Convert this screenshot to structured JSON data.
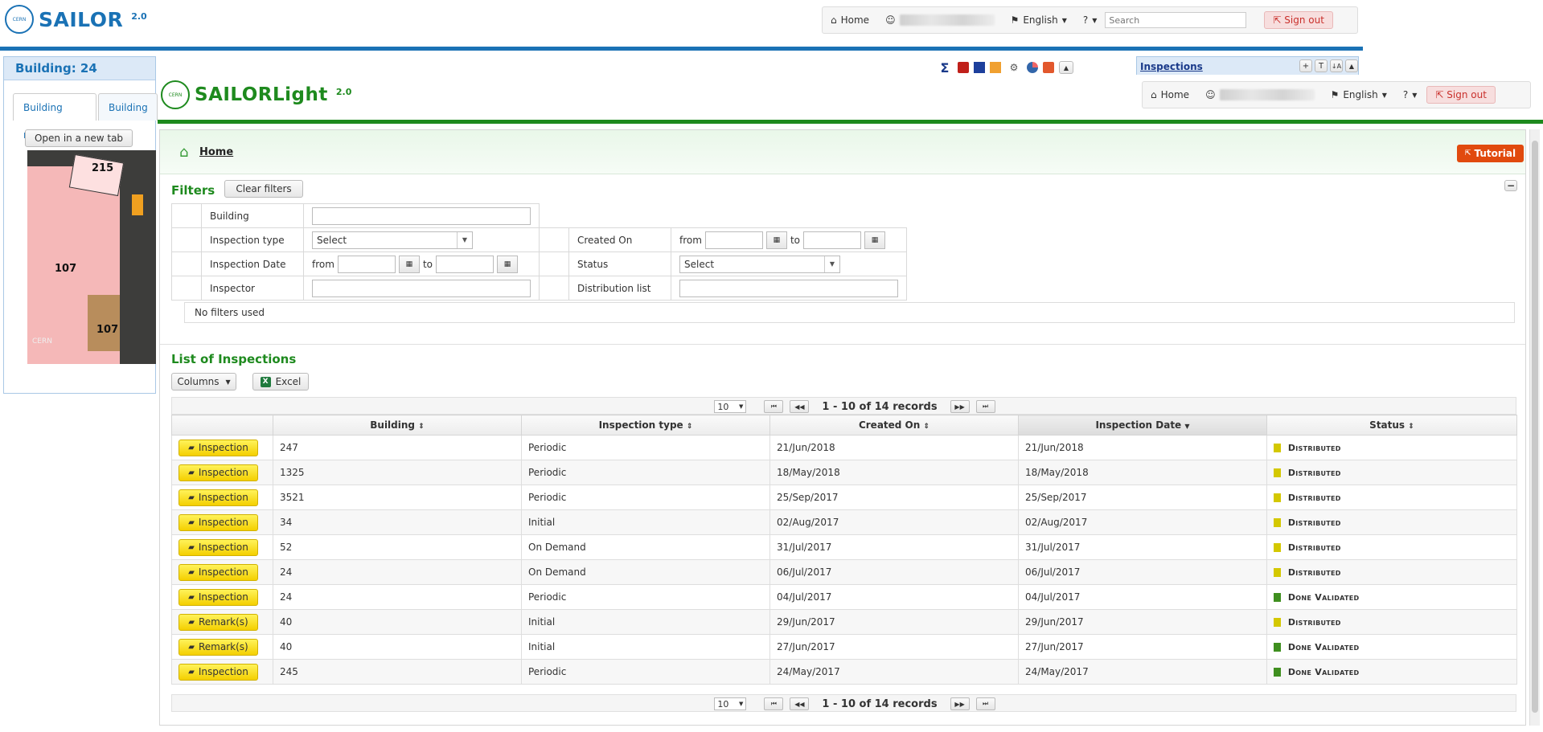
{
  "bg_app": {
    "logo_text": "SAILOR",
    "logo_version": "2.0",
    "logo_badge": "CERN",
    "nav": {
      "home": "Home",
      "language": "English",
      "help": "?",
      "search_placeholder": "Search",
      "signout": "Sign out"
    },
    "building_title": "Building: 24",
    "tabs": [
      "Building map",
      "Building p"
    ],
    "open_new_tab": "Open in a new tab",
    "map_labels": [
      "215",
      "107",
      "107",
      "CERN"
    ],
    "toolbar_first": "Σ",
    "inspections_panel_title": "Inspections",
    "panel_buttons": [
      "+",
      "T",
      "↓A",
      "▲"
    ]
  },
  "app": {
    "logo_text": "SAILORLight",
    "logo_version": "2.0",
    "logo_badge": "CERN",
    "nav": {
      "home": "Home",
      "language": "English",
      "help": "?",
      "signout": "Sign out"
    },
    "breadcrumb_home": "Home",
    "tutorial": "Tutorial"
  },
  "filters": {
    "title": "Filters",
    "clear": "Clear filters",
    "collapse": "−",
    "labels": {
      "building": "Building",
      "inspection_type": "Inspection type",
      "inspection_date": "Inspection Date",
      "inspector": "Inspector",
      "created_on": "Created On",
      "status": "Status",
      "distribution_list": "Distribution list"
    },
    "select_default": "Select",
    "from": "from",
    "to": "to",
    "summary": "No filters used"
  },
  "list": {
    "title": "List of Inspections",
    "columns_btn": "Columns",
    "excel_btn": "Excel",
    "excel_icon_letter": "X",
    "page_size": "10",
    "records_text": "1 - 10 of 14 records",
    "headers": [
      "Building",
      "Inspection type",
      "Created On",
      "Inspection Date",
      "Status"
    ],
    "rows": [
      {
        "action": "Inspection",
        "building": "247",
        "type": "Periodic",
        "created": "21/Jun/2018",
        "date": "21/Jun/2018",
        "status": "Distributed",
        "status_color": "#d4c800"
      },
      {
        "action": "Inspection",
        "building": "1325",
        "type": "Periodic",
        "created": "18/May/2018",
        "date": "18/May/2018",
        "status": "Distributed",
        "status_color": "#d4c800"
      },
      {
        "action": "Inspection",
        "building": "3521",
        "type": "Periodic",
        "created": "25/Sep/2017",
        "date": "25/Sep/2017",
        "status": "Distributed",
        "status_color": "#d4c800"
      },
      {
        "action": "Inspection",
        "building": "34",
        "type": "Initial",
        "created": "02/Aug/2017",
        "date": "02/Aug/2017",
        "status": "Distributed",
        "status_color": "#d4c800"
      },
      {
        "action": "Inspection",
        "building": "52",
        "type": "On Demand",
        "created": "31/Jul/2017",
        "date": "31/Jul/2017",
        "status": "Distributed",
        "status_color": "#d4c800"
      },
      {
        "action": "Inspection",
        "building": "24",
        "type": "On Demand",
        "created": "06/Jul/2017",
        "date": "06/Jul/2017",
        "status": "Distributed",
        "status_color": "#d4c800"
      },
      {
        "action": "Inspection",
        "building": "24",
        "type": "Periodic",
        "created": "04/Jul/2017",
        "date": "04/Jul/2017",
        "status": "Done Validated",
        "status_color": "#3f8f1f"
      },
      {
        "action": "Remark(s)",
        "building": "40",
        "type": "Initial",
        "created": "29/Jun/2017",
        "date": "29/Jun/2017",
        "status": "Distributed",
        "status_color": "#d4c800"
      },
      {
        "action": "Remark(s)",
        "building": "40",
        "type": "Initial",
        "created": "27/Jun/2017",
        "date": "27/Jun/2017",
        "status": "Done Validated",
        "status_color": "#3f8f1f"
      },
      {
        "action": "Inspection",
        "building": "245",
        "type": "Periodic",
        "created": "24/May/2017",
        "date": "24/May/2017",
        "status": "Done Validated",
        "status_color": "#3f8f1f"
      }
    ]
  },
  "colors": {
    "sailor_blue": "#1a72b5",
    "light_green": "#1e8a1e",
    "tutorial_orange": "#e14a0e",
    "action_yellow": "#f8dc12"
  }
}
